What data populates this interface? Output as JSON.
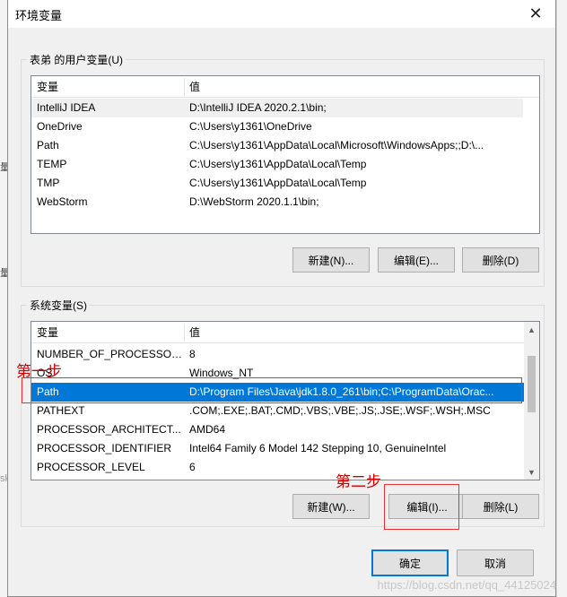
{
  "window": {
    "title": "环境变量"
  },
  "user_group": {
    "label": "表弟 的用户变量(U)",
    "columns": [
      "变量",
      "值"
    ],
    "rows": [
      {
        "name": "IntelliJ IDEA",
        "value": "D:\\IntelliJ IDEA 2020.2.1\\bin;"
      },
      {
        "name": "OneDrive",
        "value": "C:\\Users\\y1361\\OneDrive"
      },
      {
        "name": "Path",
        "value": "C:\\Users\\y1361\\AppData\\Local\\Microsoft\\WindowsApps;;D:\\..."
      },
      {
        "name": "TEMP",
        "value": "C:\\Users\\y1361\\AppData\\Local\\Temp"
      },
      {
        "name": "TMP",
        "value": "C:\\Users\\y1361\\AppData\\Local\\Temp"
      },
      {
        "name": "WebStorm",
        "value": "D:\\WebStorm 2020.1.1\\bin;"
      }
    ],
    "buttons": {
      "new": "新建(N)...",
      "edit": "编辑(E)...",
      "delete": "删除(D)"
    }
  },
  "system_group": {
    "label": "系统变量(S)",
    "columns": [
      "变量",
      "值"
    ],
    "rows": [
      {
        "name": "NUMBER_OF_PROCESSORS",
        "value": "8"
      },
      {
        "name": "OS",
        "value": "Windows_NT"
      },
      {
        "name": "Path",
        "value": "D:\\Program Files\\Java\\jdk1.8.0_261\\bin;C:\\ProgramData\\Orac..."
      },
      {
        "name": "PATHEXT",
        "value": ".COM;.EXE;.BAT;.CMD;.VBS;.VBE;.JS;.JSE;.WSF;.WSH;.MSC"
      },
      {
        "name": "PROCESSOR_ARCHITECT...",
        "value": "AMD64"
      },
      {
        "name": "PROCESSOR_IDENTIFIER",
        "value": "Intel64 Family 6 Model 142 Stepping 10, GenuineIntel"
      },
      {
        "name": "PROCESSOR_LEVEL",
        "value": "6"
      }
    ],
    "buttons": {
      "new": "新建(W)...",
      "edit": "编辑(I)...",
      "delete": "删除(L)"
    }
  },
  "footer": {
    "ok": "确定",
    "cancel": "取消"
  },
  "annotations": {
    "step1": "第一步",
    "step2": "第二步"
  },
  "watermark": "https://blog.csdn.net/qq_44125024",
  "colors": {
    "selection": "#0078d7",
    "annotation": "#e63232"
  },
  "icons": {
    "close": "close-icon",
    "scroll_up": "chevron-up-icon",
    "scroll_down": "chevron-down-icon"
  }
}
